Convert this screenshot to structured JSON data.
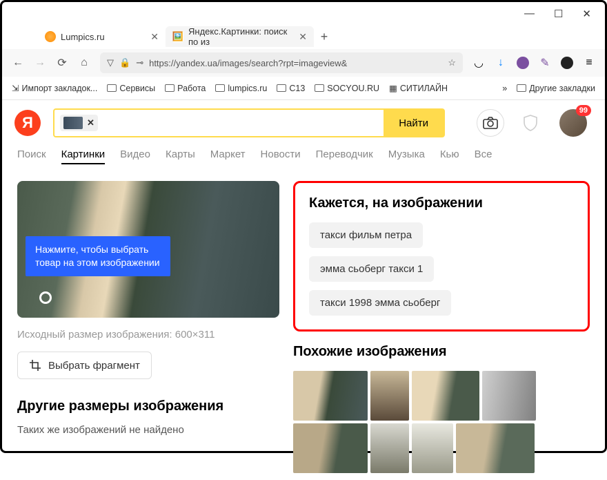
{
  "window": {
    "min": "—",
    "max": "☐",
    "close": "✕"
  },
  "tabs": {
    "t1": "Lumpics.ru",
    "t2": "Яндекс.Картинки: поиск по из",
    "close": "✕",
    "new": "+"
  },
  "nav": {
    "url": "https://yandex.ua/images/search?rpt=imageview&"
  },
  "bookmarks": {
    "b1": "Импорт закладок...",
    "b2": "Сервисы",
    "b3": "Работа",
    "b4": "lumpics.ru",
    "b5": "C13",
    "b6": "SOCYOU.RU",
    "b7": "СИТИЛАЙН",
    "more": "»",
    "other": "Другие закладки"
  },
  "search": {
    "btn": "Найти",
    "badge": "99",
    "logo": "Я"
  },
  "services": {
    "s1": "Поиск",
    "s2": "Картинки",
    "s3": "Видео",
    "s4": "Карты",
    "s5": "Маркет",
    "s6": "Новости",
    "s7": "Переводчик",
    "s8": "Музыка",
    "s9": "Кью",
    "s10": "Все"
  },
  "preview": {
    "tip": "Нажмите, чтобы выбрать товар на этом изображении",
    "meta": "Исходный размер изображения: 600×311",
    "crop": "Выбрать фрагмент"
  },
  "othersizes": {
    "title": "Другие размеры изображения",
    "text": "Таких же изображений не найдено"
  },
  "looks": {
    "title": "Кажется, на изображении",
    "chips": [
      "такси фильм петра",
      "эмма сьоберг такси 1",
      "такси 1998 эмма сьоберг"
    ]
  },
  "similar": {
    "title": "Похожие изображения"
  }
}
